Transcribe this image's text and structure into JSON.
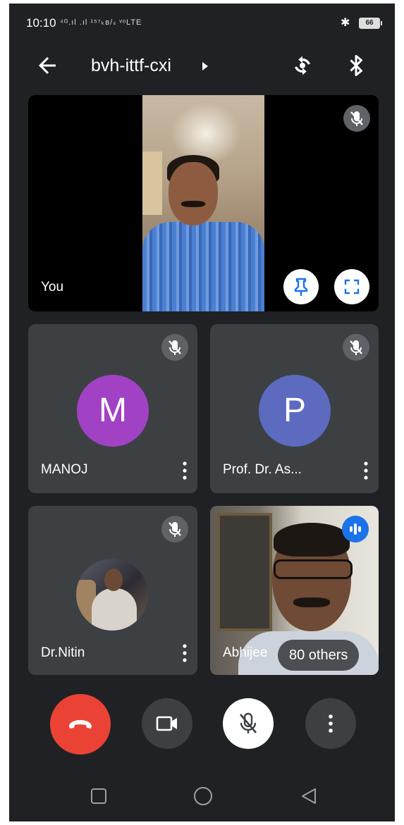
{
  "status_bar": {
    "time": "10:10",
    "network_text": "⁴ᴳ.ıl .ıl ¹⁵⁷ₖʙ/ₛ ᵛᵒLTE",
    "bluetooth": "✱",
    "battery": "66"
  },
  "app_bar": {
    "meeting_code": "bvh-ittf-cxi"
  },
  "tiles": {
    "self": {
      "name": "You"
    },
    "manoj": {
      "name": "MANOJ",
      "initial": "M",
      "color": "#a142c4"
    },
    "prof": {
      "name": "Prof. Dr. As...",
      "initial": "P",
      "color": "#5c6bc0"
    },
    "nitin": {
      "name": "Dr.Nitin"
    },
    "abhijeet": {
      "name": "Abhijee",
      "others": "80 others"
    }
  },
  "colors": {
    "background": "#202124",
    "tile": "#3c4043",
    "end_call": "#ea4335",
    "speaking": "#1a73e8"
  },
  "icons": [
    "back-arrow-icon",
    "play-caret-icon",
    "camera-flip-icon",
    "bluetooth-icon",
    "mic-off-icon",
    "pin-icon",
    "fullscreen-icon",
    "more-vert-icon",
    "speaking-icon",
    "call-end-icon",
    "videocam-icon",
    "square-icon",
    "circle-icon",
    "triangle-back-icon"
  ]
}
